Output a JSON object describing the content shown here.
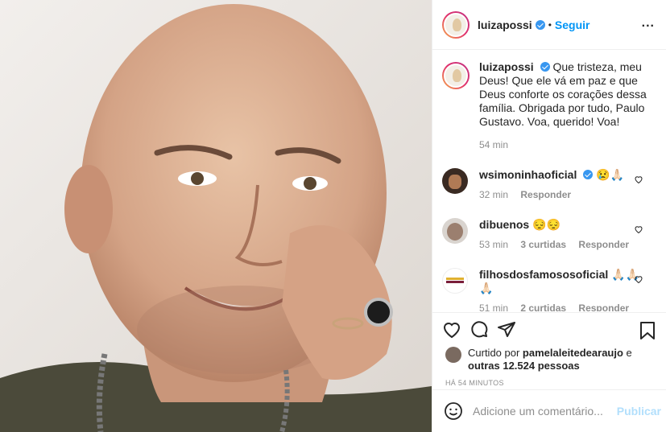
{
  "post": {
    "author": "luizapossi",
    "follow_label": "Seguir",
    "dot": "•",
    "more": "..."
  },
  "caption": {
    "author": "luizapossi",
    "text": "Que tristeza, meu Deus! Que ele vá em paz e que Deus conforte os corações dessa família. Obrigada por tudo, Paulo Gustavo. Voa, querido! Voa!",
    "time": "54 min"
  },
  "comments": [
    {
      "user": "wsimoninhaoficial",
      "text": "😢🙏🏻",
      "time": "32 min",
      "likes": "",
      "reply": "Responder"
    },
    {
      "user": "dibuenos",
      "text": "😔😔",
      "time": "53 min",
      "likes": "3 curtidas",
      "reply": "Responder"
    },
    {
      "user": "filhosdosfamososoficial",
      "text": "🙏🏻🙏🏻🙏🏻",
      "time": "51 min",
      "likes": "2 curtidas",
      "reply": "Responder"
    }
  ],
  "likes": {
    "prefix": "Curtido por ",
    "user": "pamelaleitedearaujo",
    "mid": " e",
    "others": "outras 12.524 pessoas"
  },
  "posted_ago": "HÁ 54 MINUTOS",
  "comment_box": {
    "placeholder": "Adicione um comentário...",
    "publish_label": "Publicar"
  },
  "colors": {
    "link": "#0095f6",
    "muted": "#8e8e8e",
    "publish_disabled": "#b2dffc"
  },
  "icons": [
    "heart-icon",
    "comment-icon",
    "share-icon",
    "bookmark-icon",
    "emoji-icon",
    "verified-icon"
  ]
}
